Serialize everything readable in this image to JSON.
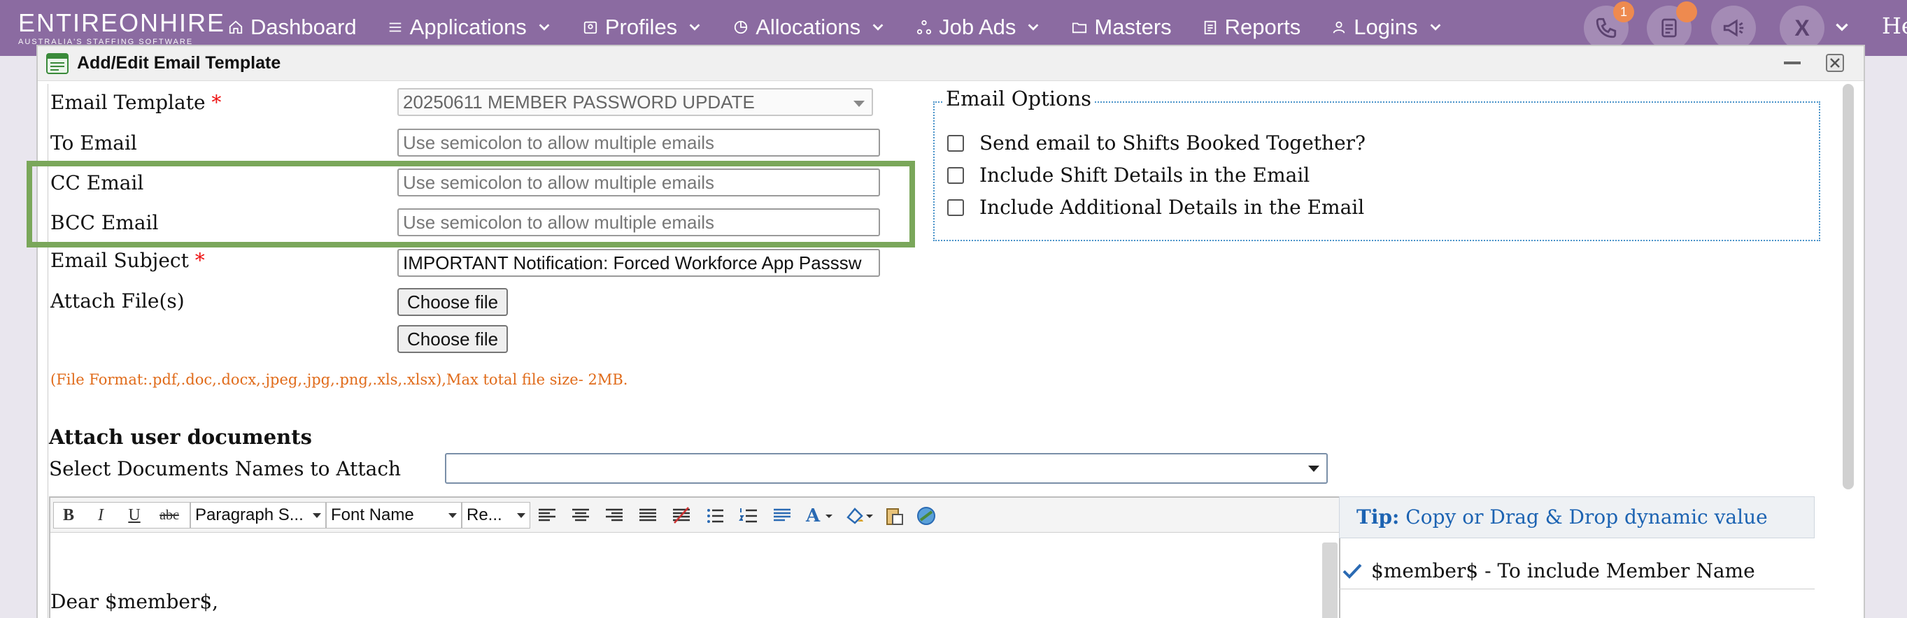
{
  "app": {
    "logo_main": "ENTIREONHIRE",
    "logo_sub": "AUSTRALIA'S STAFFING SOFTWARE",
    "greeting": "He"
  },
  "nav": [
    {
      "label": "Dashboard",
      "icon": "home-icon",
      "has_menu": false
    },
    {
      "label": "Applications",
      "icon": "list-icon",
      "has_menu": true
    },
    {
      "label": "Profiles",
      "icon": "id-card-icon",
      "has_menu": true
    },
    {
      "label": "Allocations",
      "icon": "pie-chart-icon",
      "has_menu": true
    },
    {
      "label": "Job Ads",
      "icon": "network-icon",
      "has_menu": true
    },
    {
      "label": "Masters",
      "icon": "folder-icon",
      "has_menu": false
    },
    {
      "label": "Reports",
      "icon": "document-icon",
      "has_menu": false
    },
    {
      "label": "Logins",
      "icon": "user-icon",
      "has_menu": true
    }
  ],
  "topbar_actions": {
    "phone_badge": "1",
    "avatar_initial": "X"
  },
  "dialog": {
    "title": "Add/Edit Email Template",
    "fields": {
      "email_template_label": "Email Template",
      "email_template_value": "20250611 MEMBER PASSWORD UPDATE",
      "to_email_label": "To Email",
      "to_email_placeholder": "Use semicolon to allow multiple emails",
      "cc_email_label": "CC Email",
      "cc_email_placeholder": "Use semicolon to allow multiple emails",
      "bcc_email_label": "BCC Email",
      "bcc_email_placeholder": "Use semicolon to allow multiple emails",
      "subject_label": "Email Subject",
      "subject_value": "IMPORTANT Notification: Forced Workforce App Passsw",
      "attach_label": "Attach File(s)",
      "choose_file_1": "Choose file",
      "choose_file_2": "Choose file",
      "file_hint": "(File Format:.pdf,.doc,.docx,.jpeg,.jpg,.png,.xls,.xlsx),Max total file size- 2MB.",
      "required_mark": "*"
    },
    "email_options": {
      "legend": "Email Options",
      "options": [
        "Send email to Shifts Booked Together?",
        "Include Shift Details in the Email",
        "Include Additional Details in the Email"
      ]
    },
    "attach_docs": {
      "heading": "Attach user documents",
      "select_label": "Select Documents Names to Attach"
    },
    "editor": {
      "paragraph_style": "Paragraph S...",
      "font_name": "Font Name",
      "font_size": "Re...",
      "body_text": "Dear $member$,"
    },
    "tip": {
      "prefix": "Tip:",
      "text": "Copy or Drag & Drop dynamic value",
      "item_1": "$member$ - To include Member Name"
    }
  },
  "colors": {
    "topbar": "#8b6ba1",
    "highlight": "#7aa75a",
    "required": "#ee1111",
    "hint": "#e06b1a",
    "tip_text": "#1c63b2"
  }
}
